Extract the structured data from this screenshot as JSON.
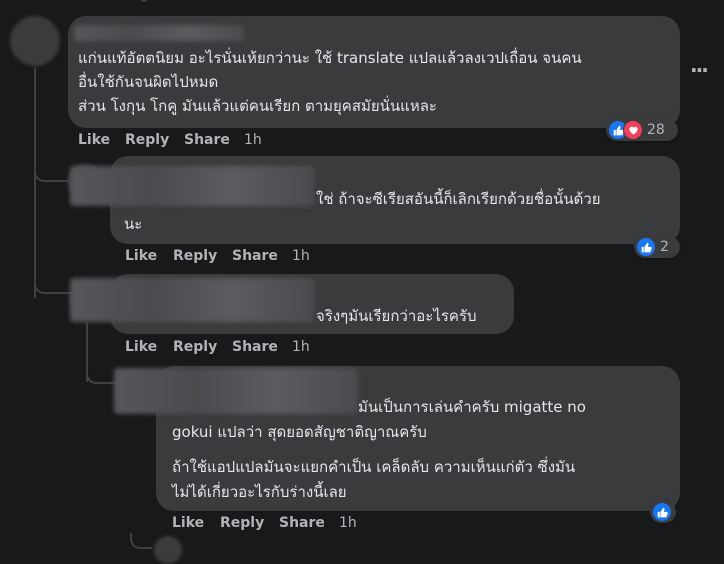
{
  "colors": {
    "background": "#18191a",
    "bubble": "#3a3b3c",
    "text": "#e4e6eb",
    "secondary": "#b0b3b8",
    "like_blue": "#1877f2",
    "love_red": "#f33e58"
  },
  "comments": [
    {
      "lines": [
        "แก่นแท้อัตตนิยม อะไรนั่นเห้ยกว่านะ ใช้ translate แปลแล้วลงเวปเถื่อน จนคน",
        "อื่นใช้กันจนผิดไปหมด",
        "ส่วน โงกุน โกคู มันแล้วแต่คนเรียก ตามยุคสมัยนั่นแหละ"
      ],
      "actions": {
        "like": "Like",
        "reply": "Reply",
        "share": "Share"
      },
      "time": "1h",
      "reactions": {
        "icons": [
          "like-icon",
          "love-icon"
        ],
        "count": "28"
      },
      "more": "···"
    },
    {
      "lines": [
        "ใช่ ถ้าจะซีเรียสอันนี้ก็เลิกเรียกด้วยชื่อนั้นด้วย",
        "นะ"
      ],
      "actions": {
        "like": "Like",
        "reply": "Reply",
        "share": "Share"
      },
      "time": "1h",
      "reactions": {
        "icons": [
          "like-icon"
        ],
        "count": "2"
      }
    },
    {
      "lines": [
        "จริงๆมันเรียกว่าอะไรครับ"
      ],
      "actions": {
        "like": "Like",
        "reply": "Reply",
        "share": "Share"
      },
      "time": "1h"
    },
    {
      "lines": [
        "มันเป็นการเล่นคำครับ migatte no",
        "gokui แปลว่า สุดยอดสัญชาติญาณครับ",
        "ถ้าใช้แอปแปลมันจะแยกคำเป็น เคล็ดลับ ความเห็นแก่ตัว ซึ่งมัน",
        "ไม่ได้เกี่ยวอะไรกับร่างนี้เลย"
      ],
      "actions": {
        "like": "Like",
        "reply": "Reply",
        "share": "Share"
      },
      "time": "1h",
      "reactions": {
        "icons": [
          "like-icon"
        ]
      }
    }
  ]
}
